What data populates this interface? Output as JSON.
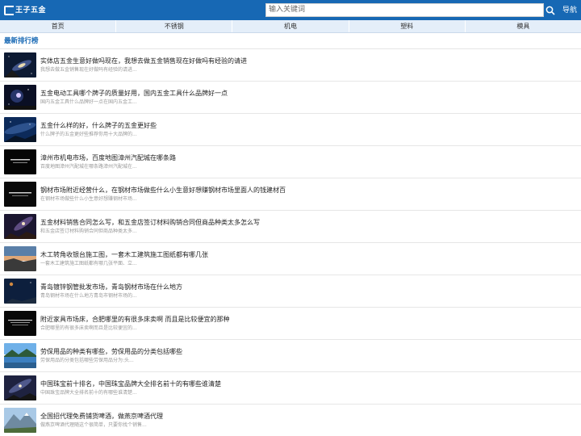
{
  "header": {
    "logo_text": "王子五金",
    "search_placeholder": "输入关键词",
    "nav_link": "导航"
  },
  "nav": [
    "首页",
    "不锈钢",
    "机电",
    "塑料",
    "模具"
  ],
  "section_title": "最新排行榜",
  "items": [
    {
      "title": "实体店五金生意好做吗现在，我想去做五金销售现在好做吗有经验的请进",
      "desc": "我想去做五金销售现在好做吗有经验的请进..."
    },
    {
      "title": "五金电动工具哪个牌子的质量好用，国内五金工具什么品牌好一点",
      "desc": "国内五金工具什么品牌好一点在国内五金工..."
    },
    {
      "title": "五金什么样的好，什么牌子的五金更好些",
      "desc": "什么牌子的五金更好些推荐你用十大品牌的..."
    },
    {
      "title": "漳州市机电市场，百度地图漳州汽配城在哪条路",
      "desc": "百度地图漳州汽配城在哪条路漳州汽配城在..."
    },
    {
      "title": "钢材市场附近经营什么，在钢材市场做些什么小生意好想赚钢材市场里面人的钱建材百",
      "desc": "在钢材市场做些什么小生意好想赚钢材市场..."
    },
    {
      "title": "五金材料销售合同怎么写，和五金店签订材料购销合同但商品种类太多怎么写",
      "desc": "和五金店签订材料购销合同但商品种类太多..."
    },
    {
      "title": "木工转角收银台施工图，一套木工建筑施工图纸都有哪几张",
      "desc": "一套木工建筑施工图纸都有哪几张平面、立..."
    },
    {
      "title": "青岛镀锌钢管批发市场，青岛钢材市场在什么地方",
      "desc": "青岛钢材市场在什么地方青岛市钢材市场的..."
    },
    {
      "title": "附近家具市场床，合肥哪里的有很多床卖啊 而且是比较便宜的那种",
      "desc": "合肥哪里的有很多床卖啊而且是比较便宜的..."
    },
    {
      "title": "劳保用品的种类有哪些，劳保用品的分类包括哪些",
      "desc": "劳保用品的分类包括哪些劳保用品分为:头..."
    },
    {
      "title": "中国珠宝前十排名，中国珠宝品牌大全排名前十的有哪些谁清楚",
      "desc": "中国珠宝品牌大全排名前十的有哪些谁清楚..."
    },
    {
      "title": "全国招代理免费铺货啤酒，做燕京啤酒代理",
      "desc": "做燕京啤酒代理随这个很简单，只要你找个销售..."
    }
  ],
  "thumb_icons": [
    "galaxy-thumbnail",
    "nebula-thumbnail",
    "night-sky-thumbnail",
    "dark-slide-thumbnail",
    "dark-slide-thumbnail",
    "galaxy-thumbnail",
    "sunset-landscape-thumbnail",
    "balloon-night-thumbnail",
    "dark-slide-thumbnail",
    "lake-landscape-thumbnail",
    "galaxy-thumbnail",
    "mountain-landscape-thumbnail"
  ],
  "colors": {
    "header_bg": "#1768b4",
    "nav_bg": "#e4eef9",
    "accent": "#1768b4"
  }
}
